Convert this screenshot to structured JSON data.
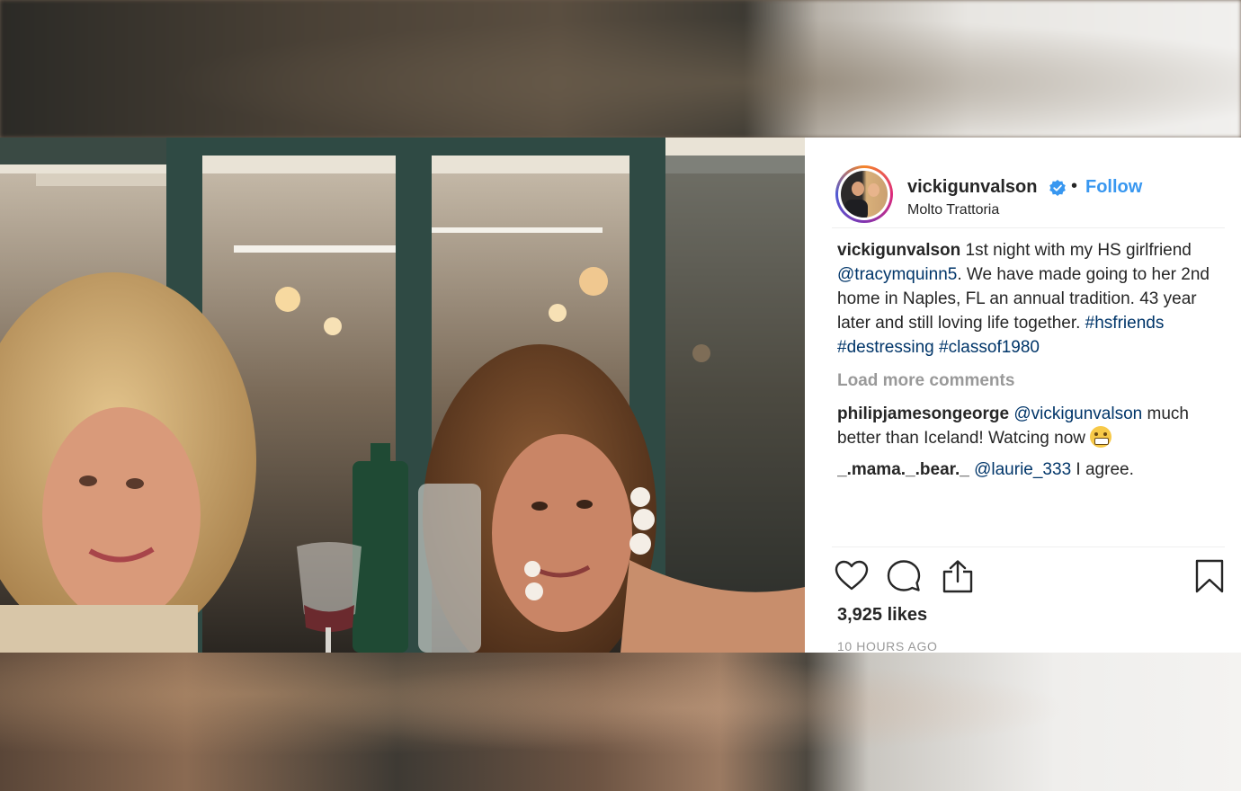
{
  "post": {
    "username": "vickigunvalson",
    "follow_label": "Follow",
    "separator": "•",
    "location": "Molto Trattoria",
    "caption": {
      "username": "vickigunvalson",
      "text_1": " 1st night with my HS girlfriend ",
      "mention": "@tracymquinn5",
      "text_2": ". We have made going to her 2nd home in Naples, FL an annual tradition. 43 year later and still loving life together. ",
      "hashtag_1": "#hsfriends",
      "hashtag_2": "#destressing",
      "hashtag_3": "#classof1980"
    },
    "load_more": "Load more comments",
    "comments": [
      {
        "username": "philipjamesongeorge",
        "mention": "@vickigunvalson",
        "text": " much better than Iceland! Watcing now ",
        "emoji": "grimacing-face-emoji"
      },
      {
        "username": "_.mama._.bear._",
        "mention": "@laurie_333",
        "text": " I agree."
      }
    ],
    "likes": "3,925 likes",
    "time": "10 HOURS AGO"
  },
  "icons": {
    "like": "heart-icon",
    "comment": "comment-bubble-icon",
    "share": "share-upload-icon",
    "save": "bookmark-icon",
    "verified": "verified-badge-icon"
  },
  "colors": {
    "follow": "#3897f0",
    "link": "#003569",
    "muted": "#999999",
    "text": "#262626"
  }
}
